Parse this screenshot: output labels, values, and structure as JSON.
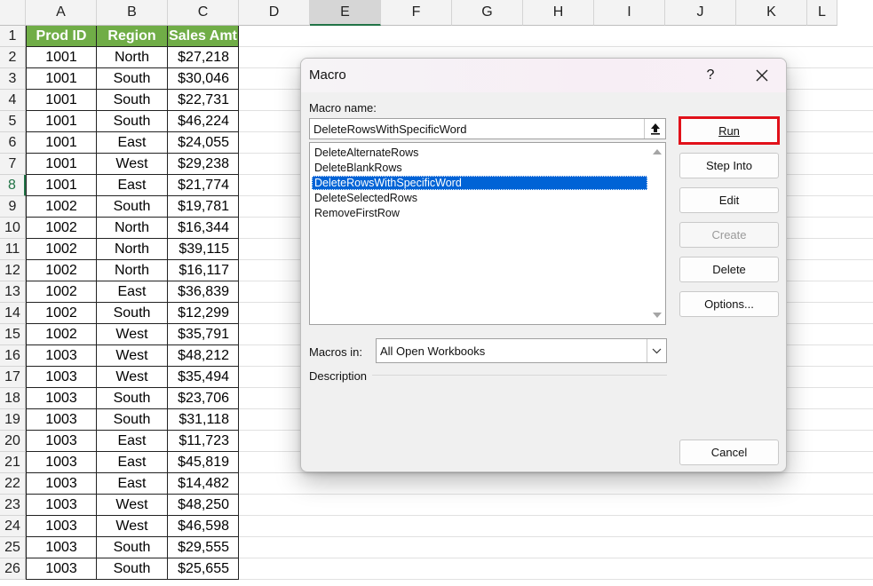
{
  "sheet": {
    "columns": [
      "A",
      "B",
      "C",
      "D",
      "E",
      "F",
      "G",
      "H",
      "I",
      "J",
      "K",
      "L"
    ],
    "headers": [
      "Prod ID",
      "Region",
      "Sales Amt"
    ],
    "rows": [
      [
        "1001",
        "North",
        "$27,218"
      ],
      [
        "1001",
        "South",
        "$30,046"
      ],
      [
        "1001",
        "South",
        "$22,731"
      ],
      [
        "1001",
        "South",
        "$46,224"
      ],
      [
        "1001",
        "East",
        "$24,055"
      ],
      [
        "1001",
        "West",
        "$29,238"
      ],
      [
        "1001",
        "East",
        "$21,774"
      ],
      [
        "1002",
        "South",
        "$19,781"
      ],
      [
        "1002",
        "North",
        "$16,344"
      ],
      [
        "1002",
        "North",
        "$39,115"
      ],
      [
        "1002",
        "North",
        "$16,117"
      ],
      [
        "1002",
        "East",
        "$36,839"
      ],
      [
        "1002",
        "South",
        "$12,299"
      ],
      [
        "1002",
        "West",
        "$35,791"
      ],
      [
        "1003",
        "West",
        "$48,212"
      ],
      [
        "1003",
        "West",
        "$35,494"
      ],
      [
        "1003",
        "South",
        "$23,706"
      ],
      [
        "1003",
        "South",
        "$31,118"
      ],
      [
        "1003",
        "East",
        "$11,723"
      ],
      [
        "1003",
        "East",
        "$45,819"
      ],
      [
        "1003",
        "East",
        "$14,482"
      ],
      [
        "1003",
        "West",
        "$48,250"
      ],
      [
        "1003",
        "West",
        "$46,598"
      ],
      [
        "1003",
        "South",
        "$29,555"
      ],
      [
        "1003",
        "South",
        "$25,655"
      ]
    ],
    "row_numbers": [
      "1",
      "2",
      "3",
      "4",
      "5",
      "6",
      "7",
      "8",
      "9",
      "10",
      "11",
      "12",
      "13",
      "14",
      "15",
      "16",
      "17",
      "18",
      "19",
      "20",
      "21",
      "22",
      "23",
      "24",
      "25",
      "26"
    ],
    "header_fill": "#70ad47"
  },
  "dialog": {
    "title": "Macro",
    "help_label": "?",
    "macro_name_label": "Macro name:",
    "macro_name_value": "DeleteRowsWithSpecificWord",
    "macros": [
      "DeleteAlternateRows",
      "DeleteBlankRows",
      "DeleteRowsWithSpecificWord",
      "DeleteSelectedRows",
      "RemoveFirstRow"
    ],
    "selected_macro_index": 2,
    "macros_in_label": "Macros in:",
    "macros_in_value": "All Open Workbooks",
    "description_label": "Description",
    "buttons": {
      "run": "Run",
      "step_into": "Step Into",
      "edit": "Edit",
      "create": "Create",
      "delete": "Delete",
      "options": "Options...",
      "cancel": "Cancel"
    },
    "highlight_color": "#e1111a",
    "selection_color": "#0063d6"
  }
}
